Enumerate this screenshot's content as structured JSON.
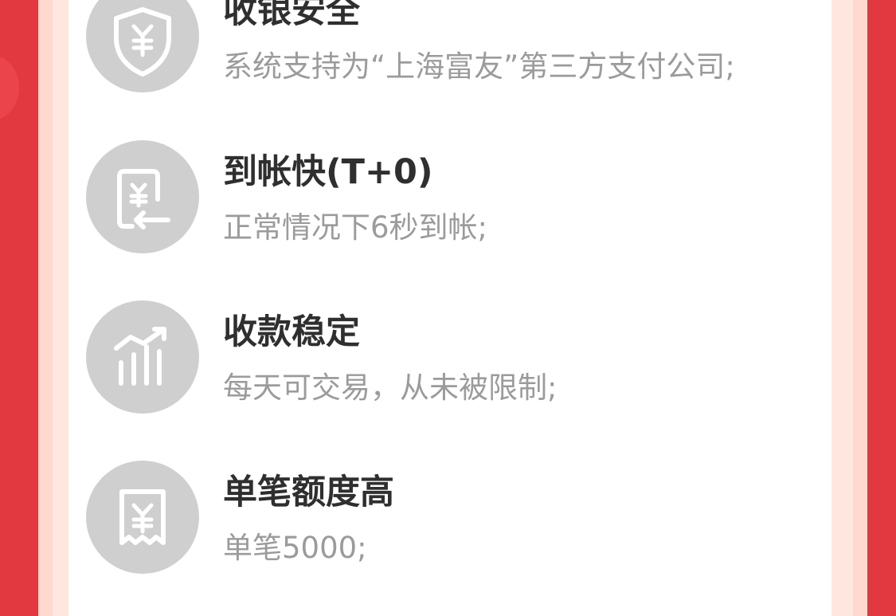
{
  "features": [
    {
      "title": "收银安全",
      "desc": "系统支持为“上海富友”第三方支付公司;",
      "icon": "shield-yen-icon"
    },
    {
      "title": "到帐快(T+0)",
      "desc": "正常情况下6秒到帐;",
      "icon": "yen-receipt-arrow-icon"
    },
    {
      "title": "收款稳定",
      "desc": "每天可交易，从未被限制;",
      "icon": "chart-bars-icon"
    },
    {
      "title": "单笔额度高",
      "desc": "单笔5000;",
      "icon": "yen-ticket-icon"
    }
  ],
  "colors": {
    "background_red": "#e2383f",
    "frame_pink": "#ffd8cf",
    "card_white": "#ffffff",
    "icon_gray": "#cfcfcf",
    "title_text": "#2f2f2f",
    "desc_text": "#9b9b9b"
  }
}
